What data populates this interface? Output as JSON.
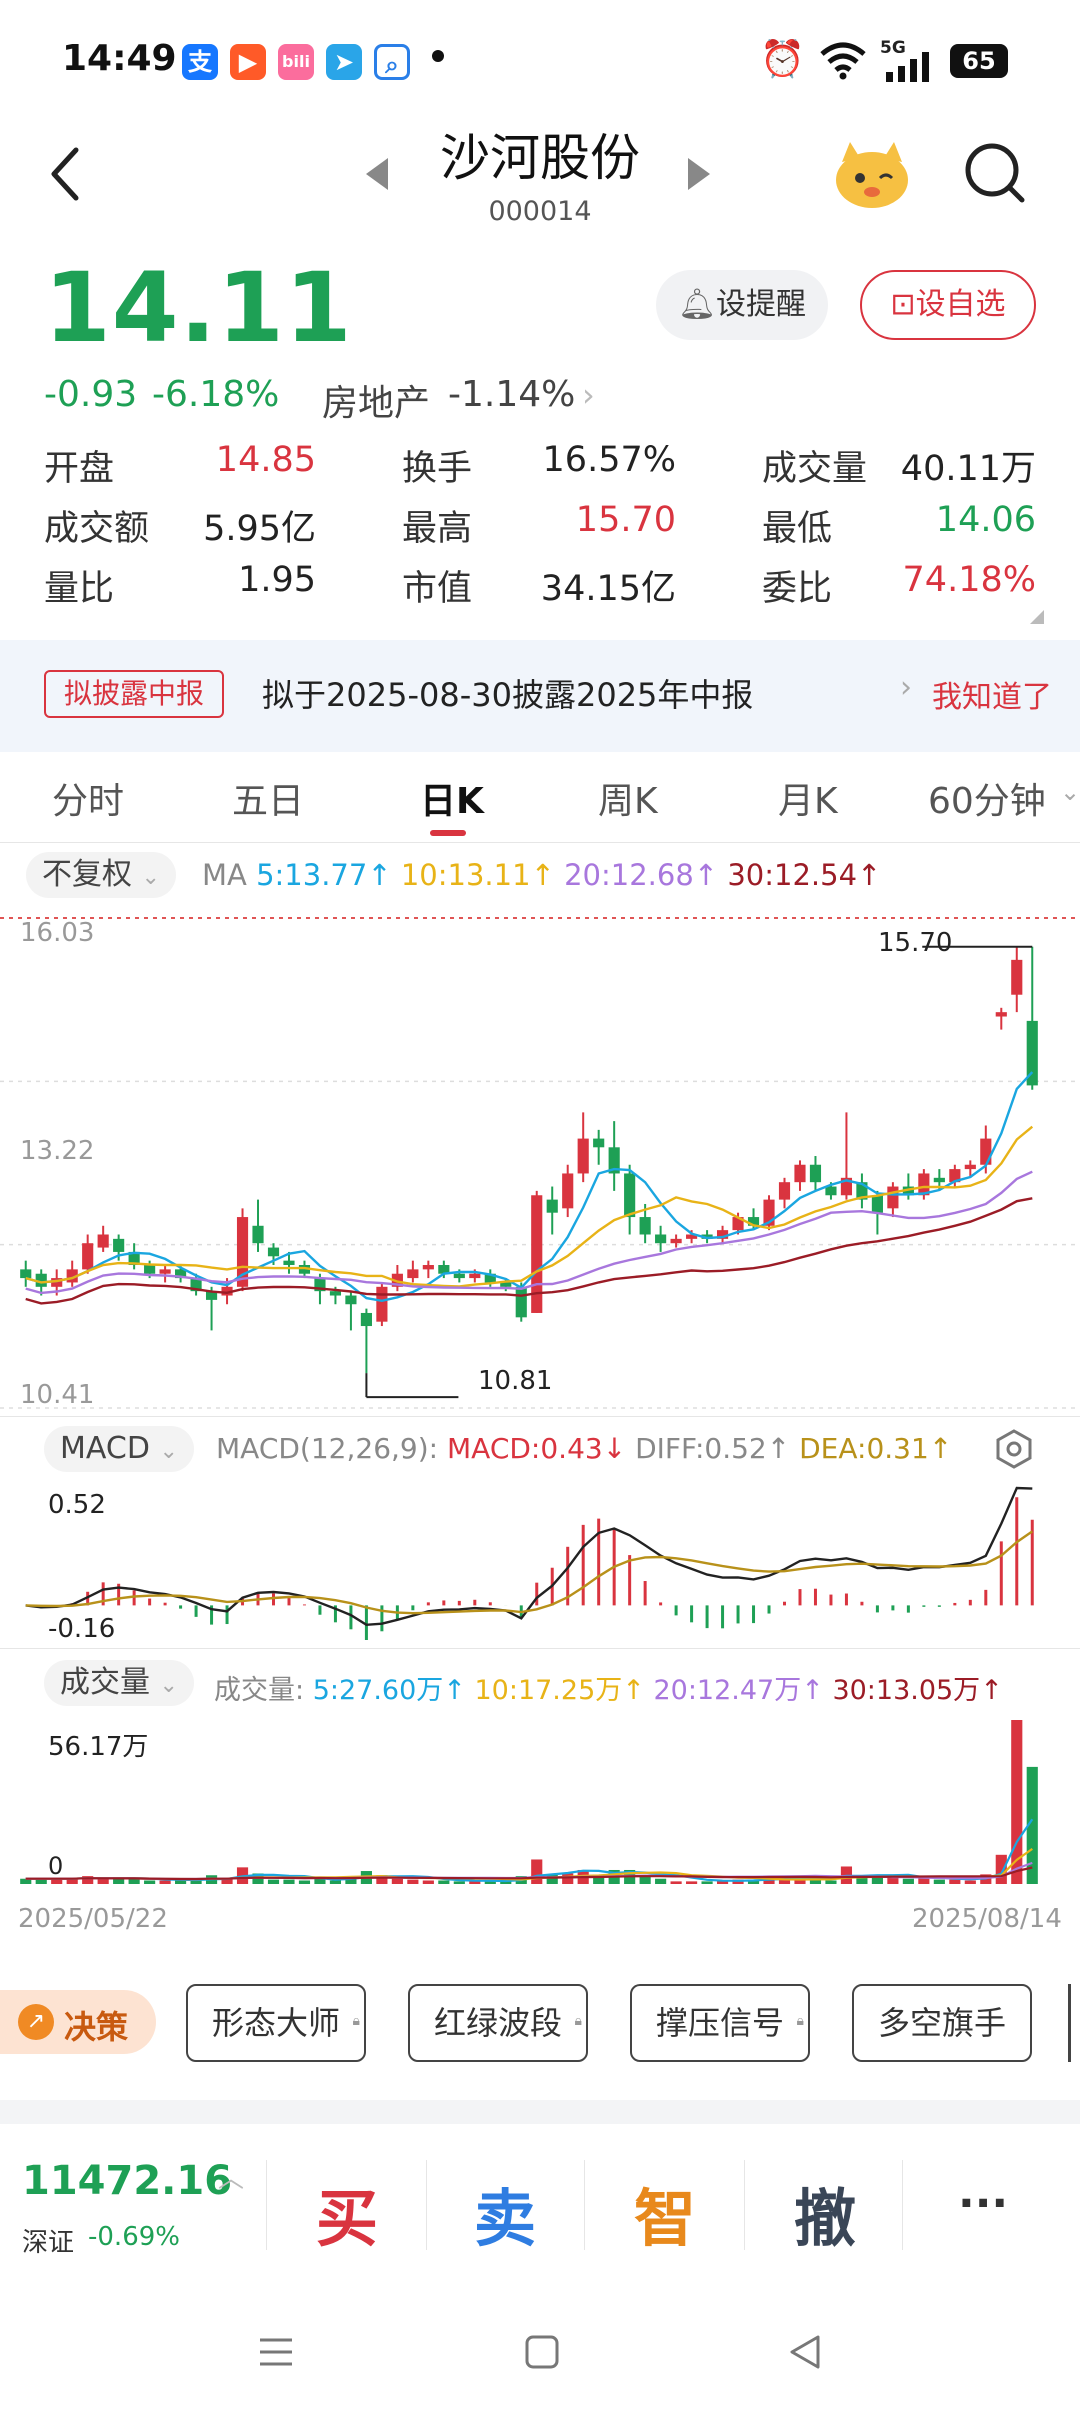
{
  "status_bar": {
    "time": "14:49",
    "network": "5G",
    "battery": "65"
  },
  "header": {
    "stock_name": "沙河股份",
    "stock_code": "000014",
    "alert_button": "设提醒",
    "watchlist_button": "设自选"
  },
  "quote": {
    "price": "14.11",
    "change": "-0.93",
    "change_pct": "-6.18%",
    "sector": "房地产",
    "sector_change": "-1.14%",
    "open_label": "开盘",
    "open": "14.85",
    "turnover_label": "换手",
    "turnover": "16.57%",
    "volume_label": "成交量",
    "volume": "40.11万",
    "amount_label": "成交额",
    "amount": "5.95亿",
    "high_label": "最高",
    "high": "15.70",
    "low_label": "最低",
    "low": "14.06",
    "vol_ratio_label": "量比",
    "vol_ratio": "1.95",
    "mkt_cap_label": "市值",
    "mkt_cap": "34.15亿",
    "order_ratio_label": "委比",
    "order_ratio": "74.18%"
  },
  "notice": {
    "tag": "拟披露中报",
    "text": "拟于2025-08-30披露2025年中报",
    "action": "我知道了"
  },
  "tabs": [
    {
      "label": "分时"
    },
    {
      "label": "五日"
    },
    {
      "label": "日K"
    },
    {
      "label": "周K"
    },
    {
      "label": "月K"
    },
    {
      "label": "60分钟"
    }
  ],
  "active_tab": "日K",
  "ma_bar": {
    "adjust": "不复权",
    "prefix": "MA",
    "ma5": "5:13.77",
    "ma10": "10:13.11",
    "ma20": "20:12.68",
    "ma30": "30:12.54",
    "up": "↑"
  },
  "kline": {
    "top_axis": "16.03",
    "mid_axis": "13.22",
    "bottom_axis": "10.41",
    "high_label": "15.70",
    "low_label": "10.81"
  },
  "macd_bar": {
    "name": "MACD",
    "params": "MACD(12,26,9):",
    "macd": "MACD:0.43",
    "macd_arrow": "↓",
    "diff": "DIFF:0.52",
    "diff_arrow": "↑",
    "dea": "DEA:0.31",
    "dea_arrow": "↑",
    "top_axis": "0.52",
    "bottom_axis": "-0.16"
  },
  "vol_bar": {
    "name": "成交量",
    "prefix": "成交量:",
    "ma5": "5:27.60万",
    "ma10": "10:17.25万",
    "ma20": "20:12.47万",
    "ma30": "30:13.05万",
    "up": "↑",
    "top_axis": "56.17万",
    "zero": "0"
  },
  "dates": {
    "start": "2025/05/22",
    "end": "2025/08/14"
  },
  "tools": {
    "decision": "决策",
    "items": [
      "形态大师",
      "红绿波段",
      "撑压信号",
      "多空旗手"
    ]
  },
  "index": {
    "value": "11472.16",
    "name": "深证",
    "change": "-0.69%"
  },
  "actions": {
    "buy": "买",
    "sell": "卖",
    "smart": "智",
    "cancel": "撤",
    "more": "···"
  },
  "colors": {
    "up": "#d9343f",
    "down": "#1ea055",
    "ma5": "#1aa6e0",
    "ma10": "#e8b317",
    "ma20": "#a877dd",
    "ma30": "#9b1c26"
  },
  "chart_data": {
    "type": "candlestick",
    "x_range": [
      "2025/05/22",
      "2025/08/14"
    ],
    "ylim": [
      10.41,
      16.03
    ],
    "annotations": {
      "high": 15.7,
      "low": 10.81
    },
    "candles": [
      [
        12.0,
        11.9,
        12.1,
        11.8
      ],
      [
        11.95,
        11.8,
        12.0,
        11.7
      ],
      [
        11.8,
        11.9,
        12.0,
        11.7
      ],
      [
        11.85,
        12.0,
        12.1,
        11.8
      ],
      [
        12.0,
        12.3,
        12.4,
        11.95
      ],
      [
        12.25,
        12.4,
        12.5,
        12.2
      ],
      [
        12.35,
        12.2,
        12.4,
        12.1
      ],
      [
        12.2,
        12.05,
        12.3,
        12.0
      ],
      [
        12.05,
        11.95,
        12.1,
        11.9
      ],
      [
        11.95,
        12.0,
        12.05,
        11.85
      ],
      [
        12.0,
        11.9,
        12.05,
        11.85
      ],
      [
        11.9,
        11.75,
        11.95,
        11.7
      ],
      [
        11.75,
        11.65,
        11.8,
        11.3
      ],
      [
        11.7,
        11.8,
        11.9,
        11.6
      ],
      [
        11.8,
        12.6,
        12.7,
        11.75
      ],
      [
        12.5,
        12.3,
        12.8,
        12.2
      ],
      [
        12.25,
        12.15,
        12.3,
        12.05
      ],
      [
        12.1,
        12.05,
        12.2,
        11.95
      ],
      [
        12.05,
        11.95,
        12.1,
        11.9
      ],
      [
        11.9,
        11.75,
        11.95,
        11.6
      ],
      [
        11.75,
        11.7,
        11.8,
        11.6
      ],
      [
        11.7,
        11.6,
        11.75,
        11.3
      ],
      [
        11.5,
        11.35,
        11.55,
        10.81
      ],
      [
        11.4,
        11.8,
        11.85,
        11.35
      ],
      [
        11.8,
        11.95,
        12.05,
        11.75
      ],
      [
        11.9,
        12.0,
        12.1,
        11.85
      ],
      [
        12.0,
        12.05,
        12.1,
        11.9
      ],
      [
        12.05,
        11.95,
        12.1,
        11.9
      ],
      [
        11.95,
        11.9,
        12.0,
        11.85
      ],
      [
        11.9,
        11.95,
        12.0,
        11.85
      ],
      [
        11.95,
        11.85,
        12.0,
        11.8
      ],
      [
        11.85,
        11.8,
        11.9,
        11.75
      ],
      [
        11.8,
        11.45,
        11.85,
        11.4
      ],
      [
        11.5,
        12.85,
        12.9,
        11.5
      ],
      [
        12.8,
        12.65,
        12.95,
        12.4
      ],
      [
        12.7,
        13.1,
        13.2,
        12.6
      ],
      [
        13.1,
        13.5,
        13.8,
        13.0
      ],
      [
        13.5,
        13.4,
        13.6,
        13.2
      ],
      [
        13.4,
        13.1,
        13.7,
        12.9
      ],
      [
        13.1,
        12.6,
        13.2,
        12.4
      ],
      [
        12.6,
        12.4,
        12.75,
        12.3
      ],
      [
        12.4,
        12.3,
        12.5,
        12.2
      ],
      [
        12.3,
        12.35,
        12.4,
        12.25
      ],
      [
        12.35,
        12.4,
        12.45,
        12.3
      ],
      [
        12.4,
        12.35,
        12.45,
        12.3
      ],
      [
        12.35,
        12.45,
        12.5,
        12.3
      ],
      [
        12.45,
        12.6,
        12.65,
        12.4
      ],
      [
        12.6,
        12.5,
        12.7,
        12.45
      ],
      [
        12.5,
        12.8,
        12.85,
        12.45
      ],
      [
        12.8,
        13.0,
        13.05,
        12.7
      ],
      [
        13.0,
        13.2,
        13.25,
        12.9
      ],
      [
        13.2,
        13.0,
        13.3,
        12.9
      ],
      [
        12.95,
        12.85,
        13.0,
        12.8
      ],
      [
        12.85,
        13.05,
        13.8,
        12.8
      ],
      [
        13.0,
        12.8,
        13.1,
        12.7
      ],
      [
        12.85,
        12.65,
        12.9,
        12.4
      ],
      [
        12.7,
        12.95,
        13.0,
        12.6
      ],
      [
        12.95,
        12.85,
        13.1,
        12.8
      ],
      [
        12.85,
        13.1,
        13.15,
        12.8
      ],
      [
        13.05,
        13.0,
        13.15,
        12.9
      ],
      [
        13.0,
        13.15,
        13.2,
        12.95
      ],
      [
        13.15,
        13.2,
        13.25,
        13.05
      ],
      [
        13.2,
        13.5,
        13.65,
        13.1
      ],
      [
        14.9,
        14.95,
        15.0,
        14.75
      ],
      [
        15.15,
        15.55,
        15.7,
        14.95
      ],
      [
        14.85,
        14.11,
        15.7,
        14.06
      ]
    ],
    "macd": {
      "diff_last": 0.52,
      "dea_last": 0.31,
      "macd_last": 0.43,
      "ylim": [
        -0.16,
        0.52
      ]
    },
    "volume": {
      "max": "56.17万",
      "last": "40.11万"
    }
  }
}
